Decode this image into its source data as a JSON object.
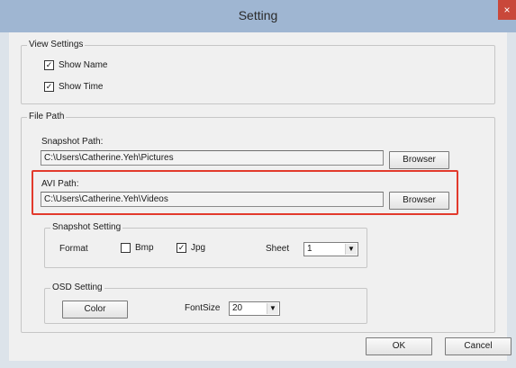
{
  "window": {
    "title": "Setting",
    "close_glyph": "×"
  },
  "view_settings": {
    "legend": "View Settings",
    "show_name": {
      "label": "Show Name",
      "checked": true
    },
    "show_time": {
      "label": "Show Time",
      "checked": true
    }
  },
  "file_path": {
    "legend": "File Path",
    "snapshot": {
      "label": "Snapshot Path:",
      "value": "C:\\Users\\Catherine.Yeh\\Pictures",
      "browse_label": "Browser"
    },
    "avi": {
      "label": "AVI Path:",
      "value": "C:\\Users\\Catherine.Yeh\\Videos",
      "browse_label": "Browser"
    },
    "highlight_color": "#e23a2c"
  },
  "snapshot_setting": {
    "legend": "Snapshot Setting",
    "format_label": "Format",
    "bmp": {
      "label": "Bmp",
      "checked": false
    },
    "jpg": {
      "label": "Jpg",
      "checked": true
    },
    "sheet_label": "Sheet",
    "sheet_value": "1"
  },
  "osd_setting": {
    "legend": "OSD Setting",
    "color_button": "Color",
    "fontsize_label": "FontSize",
    "fontsize_value": "20"
  },
  "footer": {
    "ok_label": "OK",
    "cancel_label": "Cancel"
  }
}
